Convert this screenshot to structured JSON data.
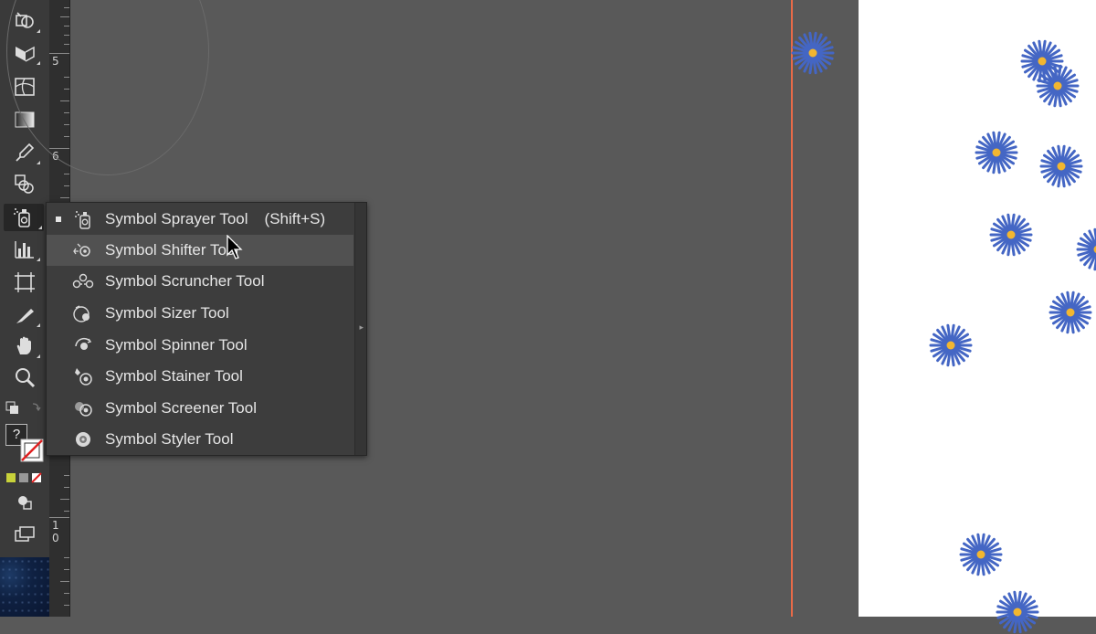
{
  "ruler": {
    "labels": [
      "5",
      "6",
      "1",
      "0"
    ]
  },
  "menu": {
    "items": [
      {
        "label": "Symbol Sprayer Tool",
        "shortcut": "(Shift+S)",
        "icon": "symbol-sprayer-icon",
        "selected": true
      },
      {
        "label": "Symbol Shifter Tool",
        "shortcut": "",
        "icon": "symbol-shifter-icon",
        "hover": true
      },
      {
        "label": "Symbol Scruncher Tool",
        "shortcut": "",
        "icon": "symbol-scruncher-icon"
      },
      {
        "label": "Symbol Sizer Tool",
        "shortcut": "",
        "icon": "symbol-sizer-icon"
      },
      {
        "label": "Symbol Spinner Tool",
        "shortcut": "",
        "icon": "symbol-spinner-icon"
      },
      {
        "label": "Symbol Stainer Tool",
        "shortcut": "",
        "icon": "symbol-stainer-icon"
      },
      {
        "label": "Symbol Screener Tool",
        "shortcut": "",
        "icon": "symbol-screener-icon"
      },
      {
        "label": "Symbol Styler Tool",
        "shortcut": "",
        "icon": "symbol-styler-icon"
      }
    ]
  },
  "toolbar": {
    "tools": [
      "shape-builder-icon",
      "perspective-grid-icon",
      "mesh-icon",
      "gradient-icon",
      "eyedropper-icon",
      "blend-icon",
      "symbol-sprayer-icon",
      "column-graph-icon",
      "artboard-icon",
      "slice-icon",
      "hand-icon",
      "zoom-icon"
    ],
    "help_glyph": "?"
  },
  "colors": {
    "canvas": "#595959",
    "toolbar": "#3a3a3a",
    "menu_bg": "#3d3d3d",
    "menu_hover": "#515151",
    "guide_line": "#e86a48",
    "flower_petal": "#4466c4",
    "flower_center": "#f2b630"
  }
}
